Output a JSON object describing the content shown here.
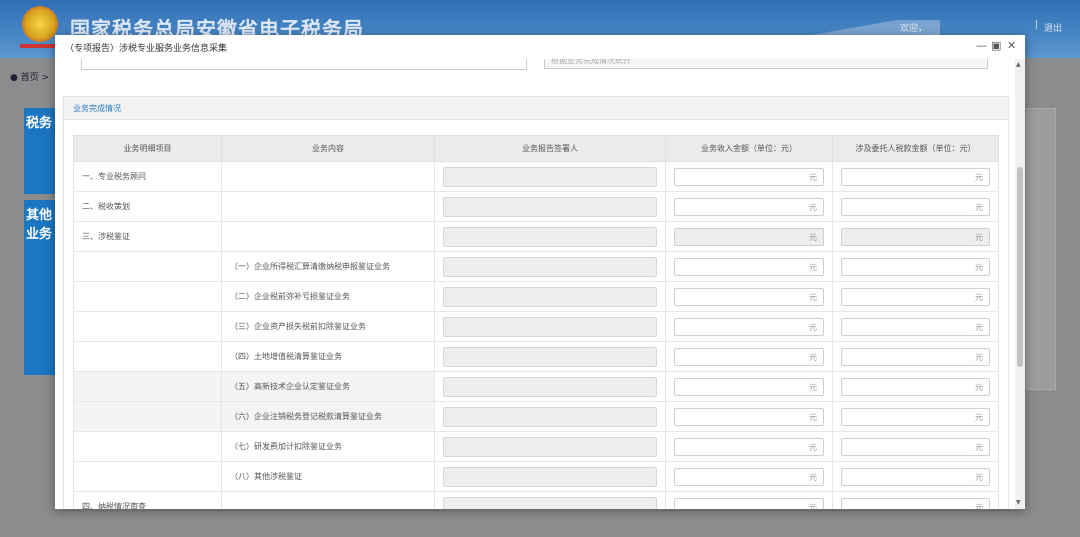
{
  "header": {
    "site_title": "国家税务总局安徽省电子税务局",
    "welcome": "欢迎，",
    "separator": "|",
    "logout": "退出"
  },
  "breadcrumb": {
    "home": "首页",
    "sep": ">"
  },
  "side_cards": [
    "税务",
    "其他业务"
  ],
  "dialog": {
    "title": "（专项报告）涉税专业服务业务信息采集",
    "prev_hint": "根据业务完成情况统计",
    "section_title": "业务完成情况",
    "columns": [
      "业务明细项目",
      "业务内容",
      "业务报告签署人",
      "业务收入金额（单位：元）",
      "涉及委托人税款金额（单位：元）"
    ],
    "unit": "元",
    "rows": [
      {
        "item": "一、专业税务顾问",
        "content": "",
        "dis": false
      },
      {
        "item": "二、税收策划",
        "content": "",
        "dis": false
      },
      {
        "item": "三、涉税鉴证",
        "content": "",
        "dis": true
      },
      {
        "item": "",
        "content": "（一）企业所得税汇算清缴纳税申报鉴证业务",
        "dis": false
      },
      {
        "item": "",
        "content": "（二）企业税前弥补亏损鉴证业务",
        "dis": false
      },
      {
        "item": "",
        "content": "（三）企业资产损失税前扣除鉴证业务",
        "dis": false
      },
      {
        "item": "",
        "content": "（四）土地增值税清算鉴证业务",
        "dis": false
      },
      {
        "item": "",
        "content": "（五）高新技术企业认定鉴证业务",
        "dis": false
      },
      {
        "item": "",
        "content": "（六）企业注销税务登记税款清算鉴证业务",
        "dis": false
      },
      {
        "item": "",
        "content": "（七）研发费加计扣除鉴证业务",
        "dis": false
      },
      {
        "item": "",
        "content": "（八）其他涉税鉴证",
        "dis": false
      },
      {
        "item": "四、纳税情况审查",
        "content": "",
        "dis": false
      }
    ]
  }
}
